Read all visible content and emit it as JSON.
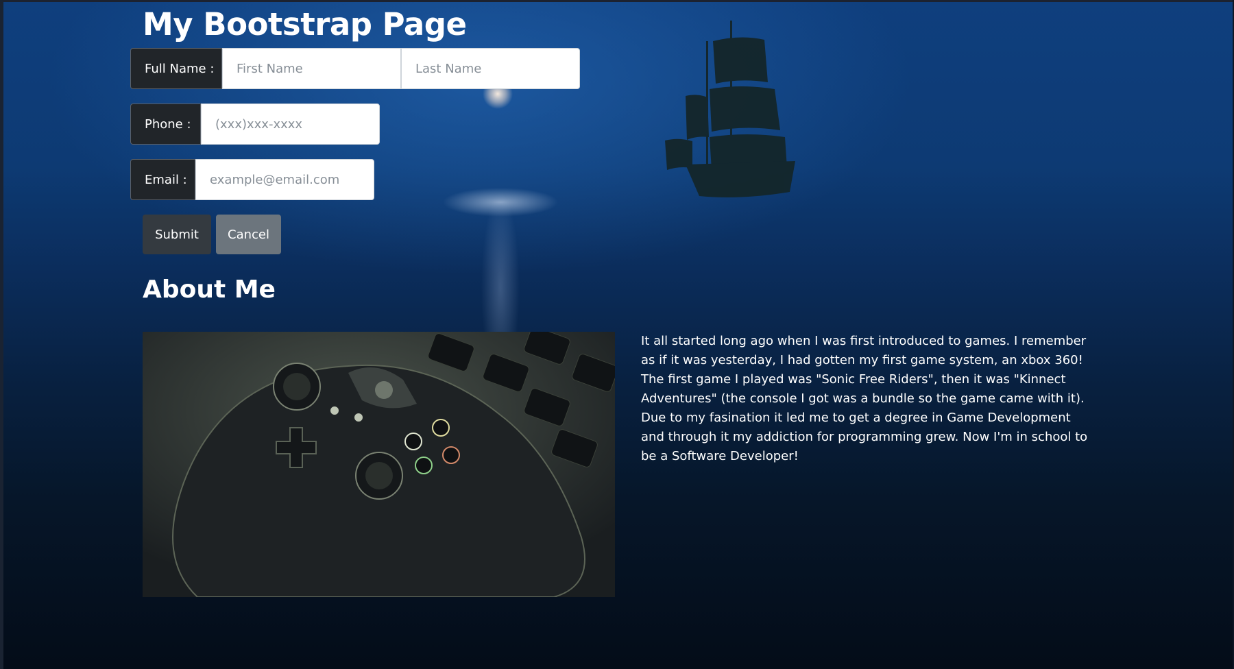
{
  "page": {
    "title": "My Bootstrap Page"
  },
  "form": {
    "full_name_label": "Full Name :",
    "first_name_placeholder": "First Name",
    "last_name_placeholder": "Last Name",
    "phone_label": "Phone :",
    "phone_placeholder": "(xxx)xxx-xxxx",
    "email_label": "Email :",
    "email_placeholder": "example@email.com",
    "submit_label": "Submit",
    "cancel_label": "Cancel"
  },
  "about": {
    "heading": "About Me",
    "paragraph": "It all started long ago when I was first introduced to games. I remember as if it was yesterday, I had gotten my first game system, an xbox 360! The first game I played was \"Sonic Free Riders\", then it was \"Kinnect Adventures\" (the console I got was a bundle so the game came with it). Due to my fasination it led me to get a degree in Game Development and through it my addiction for programming grew. Now I'm in school to be a Software Developer!"
  },
  "colors": {
    "addon_bg": "#212529",
    "submit_bg": "#343a40",
    "cancel_bg": "#6c757d",
    "background_top": "#0f3f7e",
    "background_bottom": "#040c18"
  },
  "icons": {
    "background": "night-ocean-ship-image",
    "about_photo": "game-controller-keyboard-photo"
  }
}
